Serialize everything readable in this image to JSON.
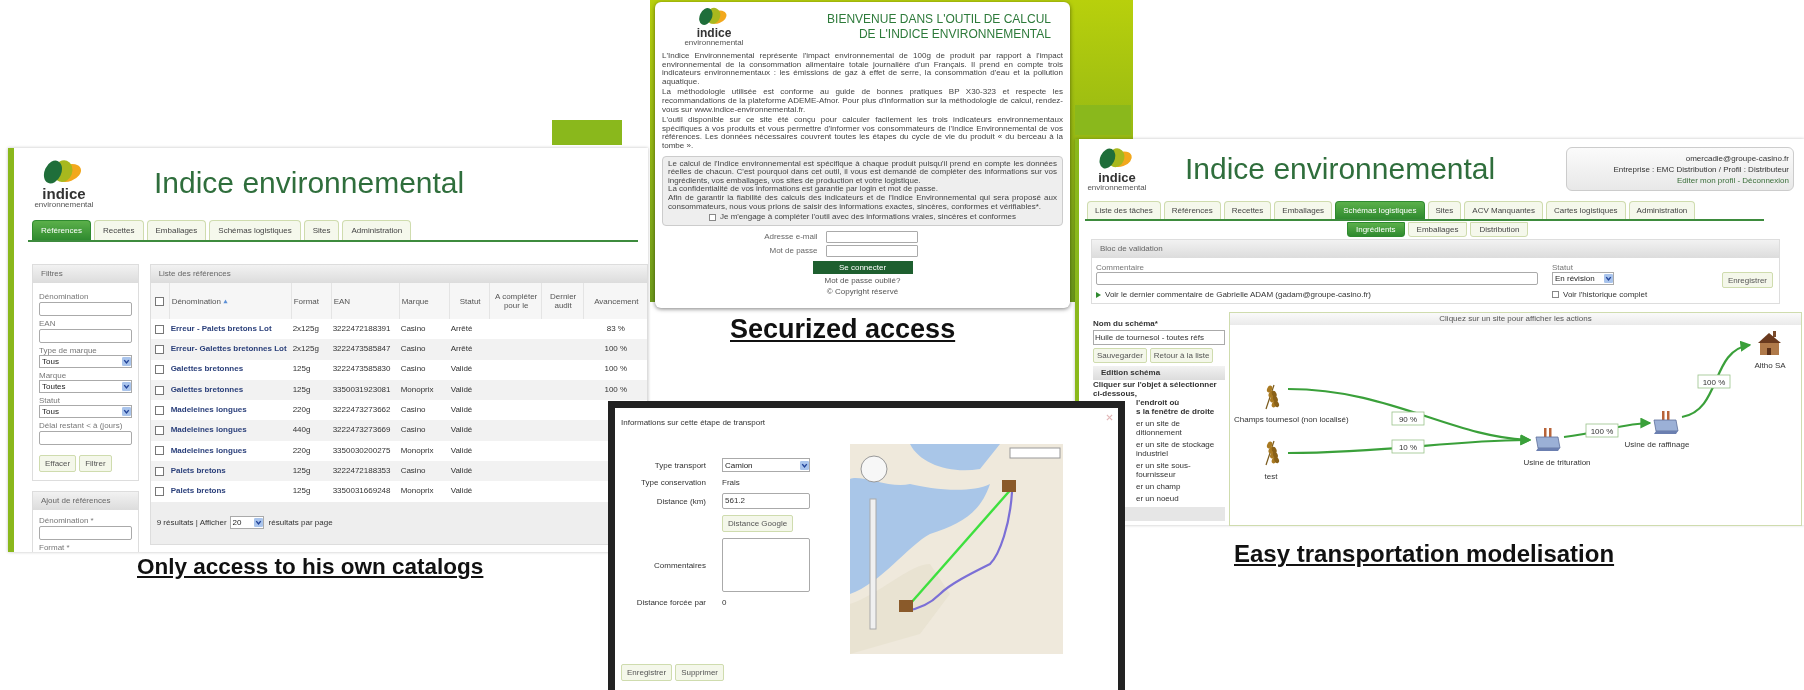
{
  "catalog_screen": {
    "logo": {
      "word": "indice",
      "tagline": "environnemental"
    },
    "app_title": "Indice environnemental",
    "tabs": [
      {
        "label": "Références",
        "selected": true
      },
      {
        "label": "Recettes",
        "selected": false
      },
      {
        "label": "Emballages",
        "selected": false
      },
      {
        "label": "Schémas logistiques",
        "selected": false
      },
      {
        "label": "Sites",
        "selected": false
      },
      {
        "label": "Administration",
        "selected": false
      }
    ],
    "filters": {
      "title": "Filtres",
      "fields": [
        {
          "kind": "input",
          "label": "Dénomination"
        },
        {
          "kind": "input",
          "label": "EAN"
        },
        {
          "kind": "select",
          "label": "Type de marque",
          "value": "Tous"
        },
        {
          "kind": "select",
          "label": "Marque",
          "value": "Toutes"
        },
        {
          "kind": "select",
          "label": "Statut",
          "value": "Tous"
        },
        {
          "kind": "input",
          "label": "Délai restant < à (jours)"
        }
      ],
      "buttons": [
        "Effacer",
        "Filtrer"
      ]
    },
    "add_panel": {
      "title": "Ajout de références",
      "fields": [
        "Dénomination *",
        "Format *"
      ]
    },
    "table": {
      "title": "Liste des références",
      "select_all_checked": false,
      "columns": [
        {
          "label": "Dénomination",
          "sorted": true
        },
        {
          "label": "Format",
          "sorted": false
        },
        {
          "label": "EAN",
          "sorted": false
        },
        {
          "label": "Marque",
          "sorted": false
        },
        {
          "label": "Statut",
          "sorted": false
        },
        {
          "label": "A compléter pour le",
          "sorted": false
        },
        {
          "label": "Dernier audit",
          "sorted": false
        },
        {
          "label": "Avancement",
          "sorted": false
        }
      ],
      "rows": [
        {
          "checked": false,
          "name": "Erreur - Palets bretons Lot",
          "format": "2x125g",
          "ean": "3222472188391",
          "brand": "Casino",
          "status": "Arrêté",
          "progress": "83 %"
        },
        {
          "checked": false,
          "name": "Erreur- Galettes bretonnes Lot",
          "format": "2x125g",
          "ean": "3222473585847",
          "brand": "Casino",
          "status": "Arrêté",
          "progress": "100 %"
        },
        {
          "checked": false,
          "name": "Galettes bretonnes",
          "format": "125g",
          "ean": "3222473585830",
          "brand": "Casino",
          "status": "Validé",
          "progress": "100 %"
        },
        {
          "checked": false,
          "name": "Galettes bretonnes",
          "format": "125g",
          "ean": "3350031923081",
          "brand": "Monoprix",
          "status": "Validé",
          "progress": "100 %"
        },
        {
          "checked": false,
          "name": "Madeleines longues",
          "format": "220g",
          "ean": "3222473273662",
          "brand": "Casino",
          "status": "Validé"
        },
        {
          "checked": false,
          "name": "Madeleines longues",
          "format": "440g",
          "ean": "3222473273669",
          "brand": "Casino",
          "status": "Validé"
        },
        {
          "checked": false,
          "name": "Madeleines longues",
          "format": "220g",
          "ean": "3350030200275",
          "brand": "Monoprix",
          "status": "Validé"
        },
        {
          "checked": false,
          "name": "Palets bretons",
          "format": "125g",
          "ean": "3222472188353",
          "brand": "Casino",
          "status": "Validé"
        },
        {
          "checked": false,
          "name": "Palets bretons",
          "format": "125g",
          "ean": "3350031669248",
          "brand": "Monoprix",
          "status": "Validé"
        }
      ],
      "footer": {
        "summary": "9 résultats | Afficher",
        "page_size": "20",
        "suffix": "résultats par page"
      }
    },
    "caption": "Only access to his own catalogs"
  },
  "login_screen": {
    "logo": {
      "word": "indice",
      "tagline": "environnemental"
    },
    "heading": [
      "BIENVENUE DANS L'OUTIL DE CALCUL",
      "DE L'INDICE ENVIRONNEMENTAL"
    ],
    "paragraphs": [
      "L'Indice Environnemental représente l'impact environnemental de 100g de produit par rapport à l'impact environnemental de la consommation alimentaire totale journalière d'un Français. Il prend en compte trois indicateurs environnementaux : les émissions de gaz à effet de serre, la consommation d'eau et la pollution aquatique.",
      "La méthodologie utilisée est conforme au guide de bonnes pratiques BP X30-323 et respecte les recommandations de la plateforme ADEME-Afnor. Pour plus d'information sur la méthodologie de calcul, rendez-vous sur www.indice-environnemental.fr.",
      "L'outil disponible sur ce site été conçu pour calculer facilement les trois indicateurs environnementaux spécifiques à vos produits et vous permettre d'informer vos consommateurs de l'Indice Environnemental de vos références. Les données nécessaires couvrent toutes les étapes du cycle de vie du produit « du berceau à la tombe »."
    ],
    "notice": {
      "paragraphs": [
        "Le calcul de l'Indice environnemental est spécifique à chaque produit puisqu'il prend en compte les données réelles de chacun. C'est pourquoi dans cet outil, il vous est demandé de compléter des informations sur vos ingrédients, vos emballages, vos sites de production et votre logistique.",
        "La confidentialité de vos informations est garantie par login et mot de passe.",
        "Afin de garantir la fiabilité des calculs des indicateurs et de l'Indice Environnemental qui sera proposé aux consommateurs, nous vous prions de saisir des informations exactes, sincères, conformes et vérifiables*."
      ],
      "consent": {
        "label": "Je m'engage à compléter l'outil avec des informations vraies, sincères et conformes",
        "checked": false
      }
    },
    "fields": [
      {
        "label": "Adresse e-mail"
      },
      {
        "label": "Mot de passe"
      }
    ],
    "button": "Se connecter",
    "forgot_link": "Mot de passe oublié?",
    "copyright": "© Copyright réservé",
    "caption": "Securized access"
  },
  "schema_screen": {
    "logo": {
      "word": "indice",
      "tagline": "environnemental"
    },
    "app_title": "Indice environnemental",
    "user_box": {
      "email": "omercadie@groupe-casino.fr",
      "company": "Entreprise : EMC Distribution / Profil : Distributeur",
      "links": "Editer mon profil - Déconnexion"
    },
    "tabs": [
      {
        "label": "Liste des tâches",
        "selected": false
      },
      {
        "label": "Références",
        "selected": false
      },
      {
        "label": "Recettes",
        "selected": false
      },
      {
        "label": "Emballages",
        "selected": false
      },
      {
        "label": "Schémas logistiques",
        "selected": true
      },
      {
        "label": "Sites",
        "selected": false
      },
      {
        "label": "ACV Manquantes",
        "selected": false
      },
      {
        "label": "Cartes logistiques",
        "selected": false
      },
      {
        "label": "Administration",
        "selected": false
      }
    ],
    "subtabs": [
      {
        "label": "Ingrédients",
        "selected": true
      },
      {
        "label": "Emballages",
        "selected": false
      },
      {
        "label": "Distribution",
        "selected": false
      }
    ],
    "validation": {
      "title": "Bloc de validation",
      "comment_label": "Commentaire",
      "status_label": "Statut",
      "status_value": "En révision",
      "save_button": "Enregistrer",
      "last_comment": "Voir le dernier commentaire de Gabrielle ADAM (gadam@groupe-casino.fr)",
      "history_label": "Voir l'historique complet",
      "history_checked": false
    },
    "schema_form": {
      "name_label": "Nom du schéma*",
      "name_value": "Huile de tournesol - toutes réfs",
      "buttons": [
        "Sauvegarder",
        "Retour à la liste"
      ],
      "edit_title": "Edition schéma",
      "instructions": [
        "Cliquer sur l'objet à sélectionner ci-dessous,",
        "l'endroit où",
        "s la fenêtre de droite"
      ],
      "actions": [
        "er un site de",
        "ditionnement",
        "er un site de stockage industriel",
        "er un site sous-fournisseur",
        "er un champ",
        "er un noeud"
      ]
    },
    "diagram": {
      "header": "Cliquez sur un site pour afficher les actions",
      "nodes": [
        {
          "kind": "field",
          "label": "Champs tournesol (non localisé)"
        },
        {
          "kind": "field",
          "label": "test"
        },
        {
          "kind": "factory",
          "label": "Usine de trituration"
        },
        {
          "kind": "factory",
          "label": "Usine de raffinage"
        },
        {
          "kind": "house",
          "label": "Altho SA"
        }
      ],
      "edges": [
        {
          "label": "90 %"
        },
        {
          "label": "10 %"
        },
        {
          "label": "100 %"
        },
        {
          "label": "100 %"
        }
      ]
    },
    "caption": "Easy transportation modelisation"
  },
  "transport_dialog": {
    "title": "Informations sur cette étape de transport",
    "fields": [
      {
        "kind": "select",
        "label": "Type transport",
        "value": "Camion"
      },
      {
        "kind": "text",
        "label": "Type conservation",
        "value": "Frais"
      },
      {
        "kind": "input",
        "label": "Distance (km)",
        "value": "561.2"
      },
      {
        "kind": "button",
        "value": "Distance Google"
      },
      {
        "kind": "textarea",
        "label": "Commentaires"
      },
      {
        "kind": "text",
        "label": "Distance forcée par",
        "value": "0"
      }
    ],
    "buttons": [
      "Enregistrer",
      "Supprimer"
    ]
  }
}
